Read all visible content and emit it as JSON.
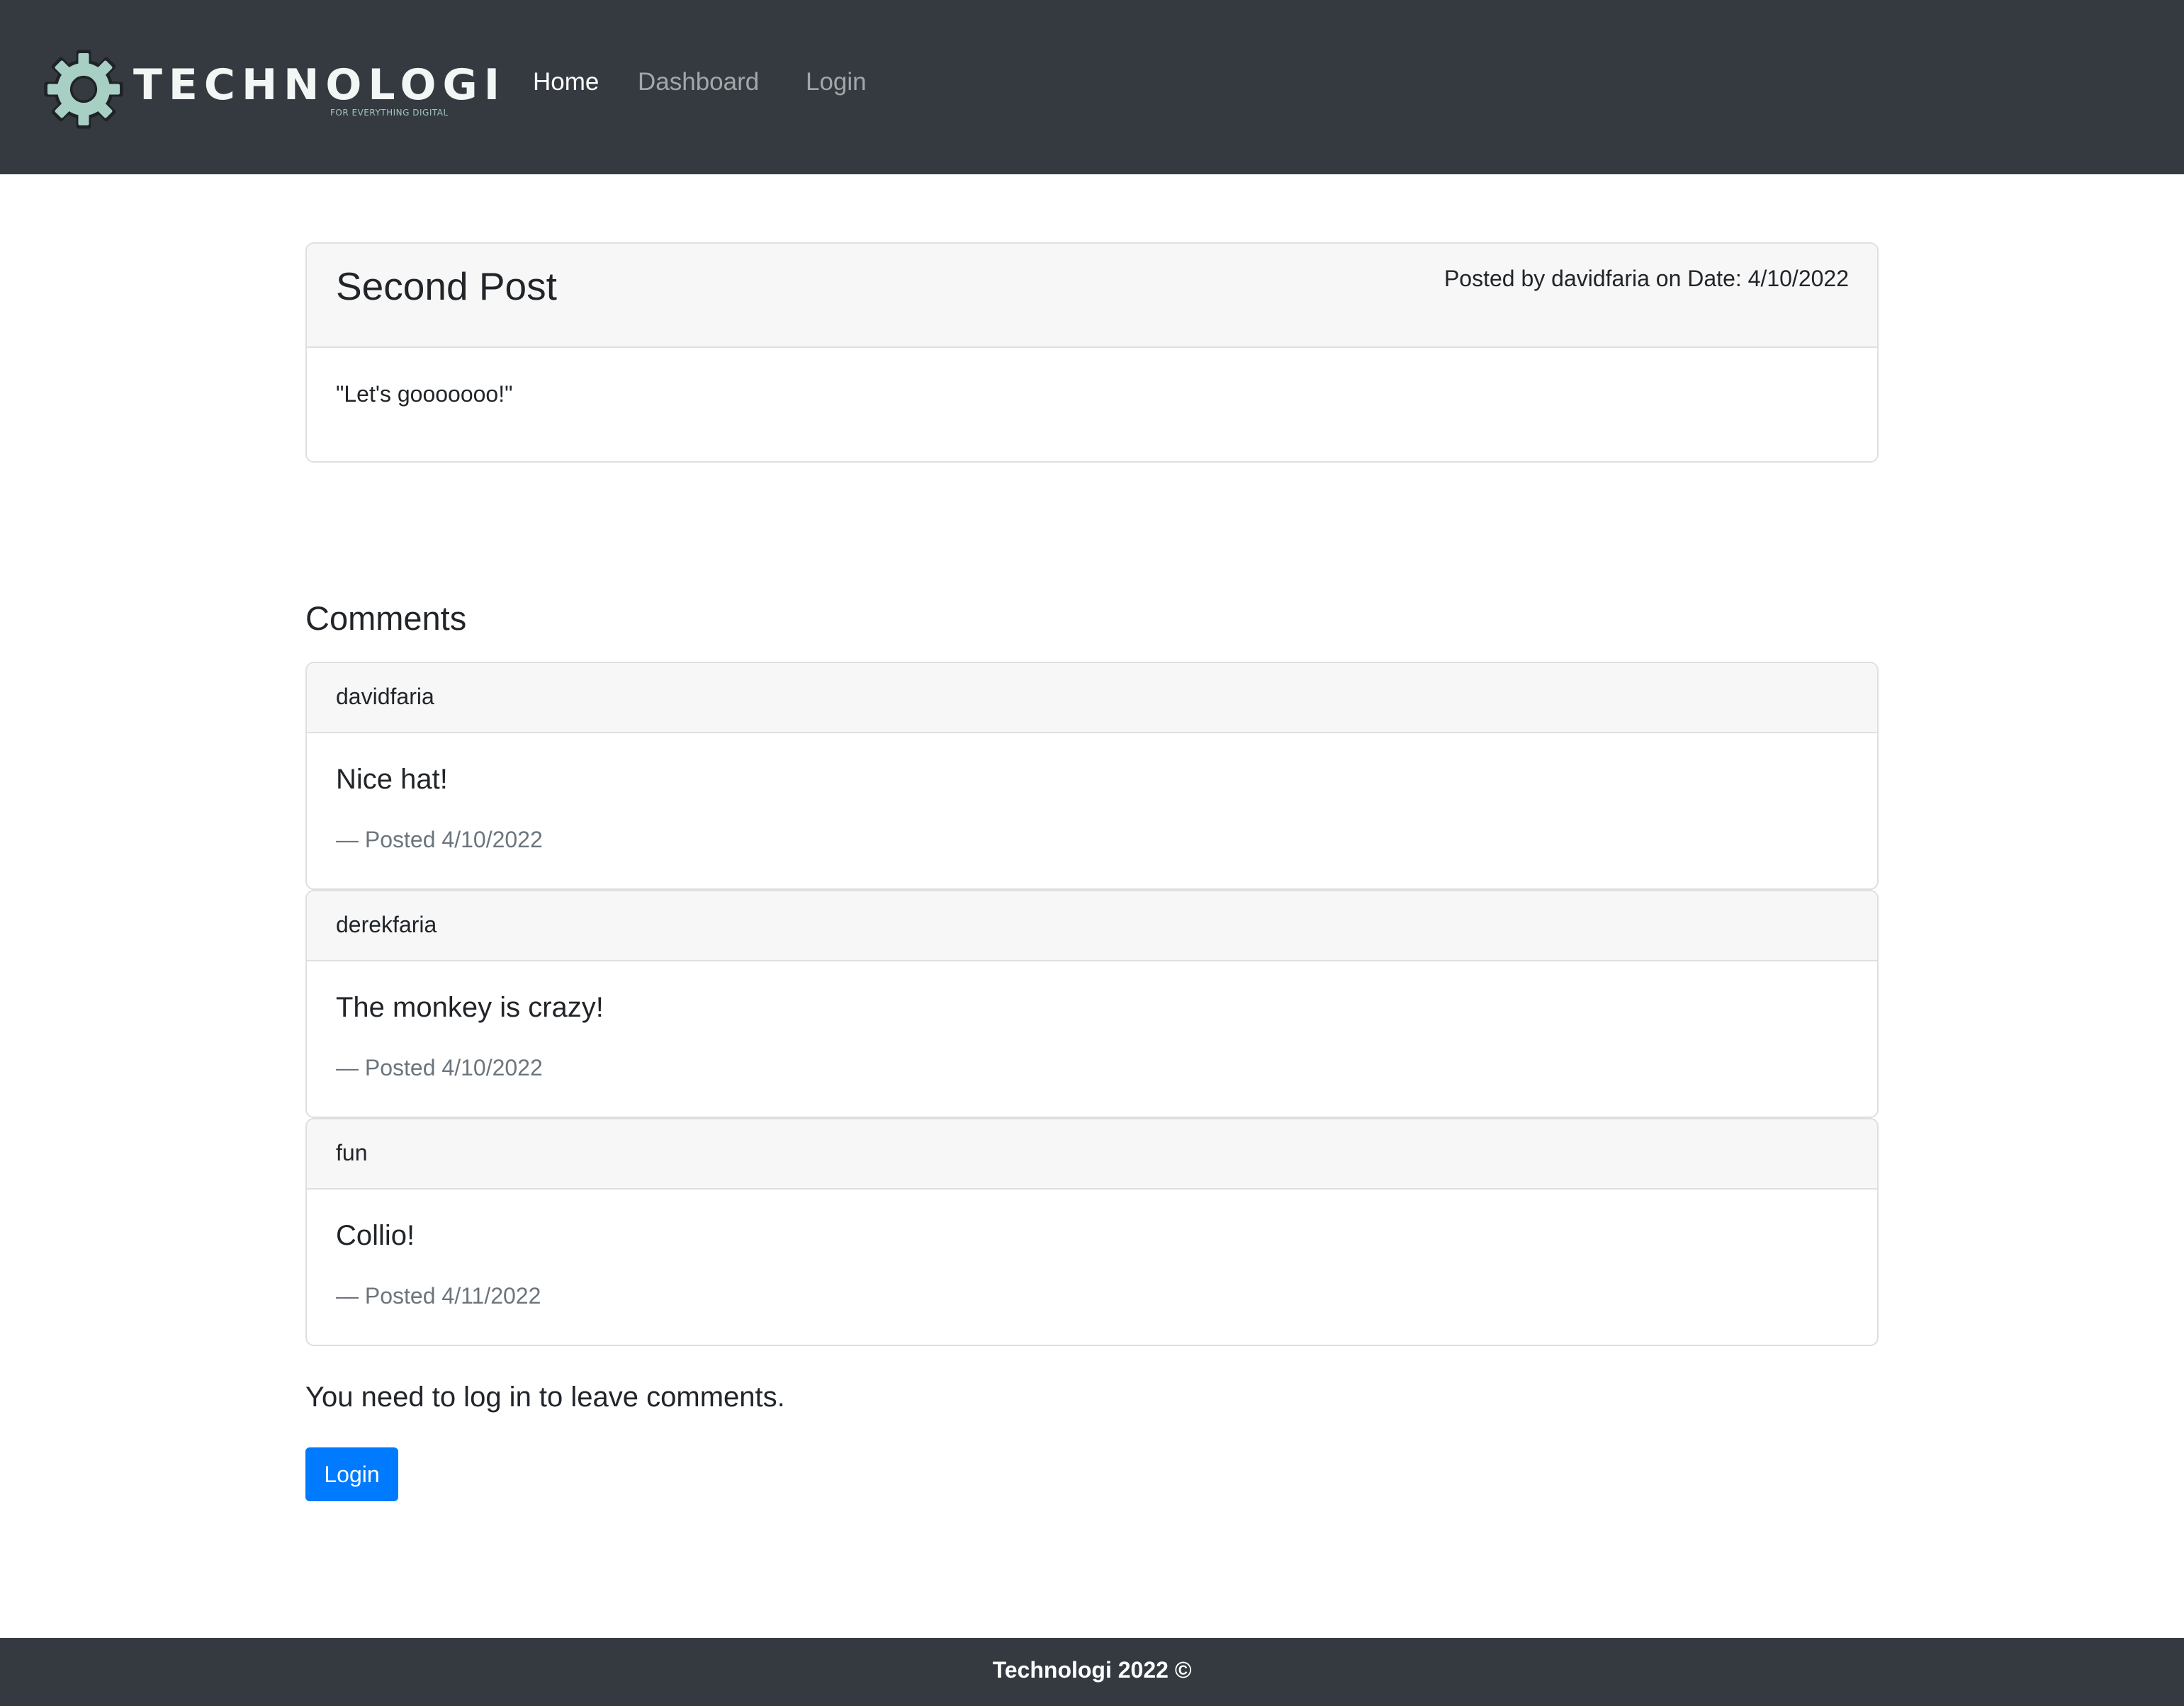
{
  "navbar": {
    "brand_name": "TECHNOLOGI",
    "brand_tagline": "FOR EVERYTHING DIGITAL",
    "links": [
      {
        "label": "Home",
        "active": true
      },
      {
        "label": "Dashboard",
        "active": false
      },
      {
        "label": "Login",
        "active": false
      }
    ],
    "background_color": "#343a40",
    "logo_icon": "gear-icon"
  },
  "post": {
    "title": "Second Post",
    "meta": "Posted by davidfaria on Date: 4/10/2022",
    "body": "\"Let's gooooooo!\""
  },
  "comments": {
    "heading": "Comments",
    "items": [
      {
        "user": "davidfaria",
        "text": "Nice hat!",
        "posted": "— Posted 4/10/2022"
      },
      {
        "user": "derekfaria",
        "text": "The monkey is crazy!",
        "posted": "— Posted 4/10/2022"
      },
      {
        "user": "fun",
        "text": "Collio!",
        "posted": "— Posted 4/11/2022"
      }
    ]
  },
  "login_prompt": {
    "message": "You need to log in to leave comments.",
    "button_label": "Login",
    "button_color": "#007bff"
  },
  "footer": {
    "text": "Technologi 2022 ©"
  }
}
